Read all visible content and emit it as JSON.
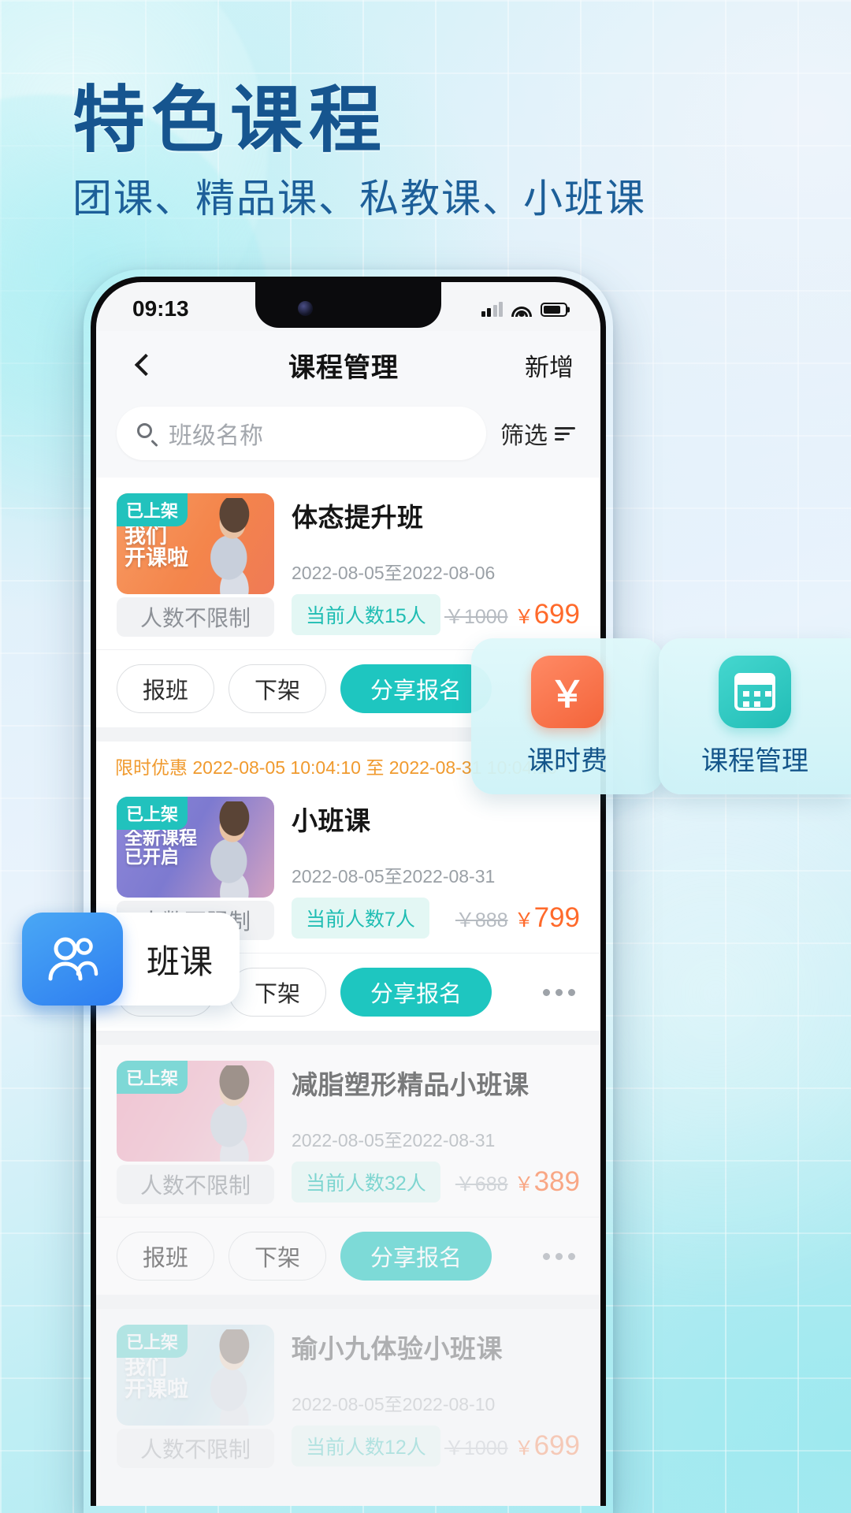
{
  "promo": {
    "title": "特色课程",
    "subtitle": "团课、精品课、私教课、小班课",
    "title_color": "#16558f"
  },
  "status_bar": {
    "time": "09:13",
    "signal_icon": "signal-bars-icon",
    "wifi_icon": "wifi-icon",
    "battery_icon": "battery-icon"
  },
  "appbar": {
    "back_icon": "back-chevron-icon",
    "title": "课程管理",
    "action_label": "新增"
  },
  "search": {
    "icon": "search-icon",
    "placeholder": "班级名称",
    "value": "",
    "filter_label": "筛选",
    "filter_icon": "filter-lines-icon"
  },
  "actions": {
    "enroll": "报班",
    "unlist": "下架",
    "share": "分享报名",
    "more_icon": "more-dots-icon"
  },
  "labels": {
    "capacity_unlimited": "人数不限制",
    "status_listed": "已上架"
  },
  "cards": [
    {
      "badge": "已上架",
      "thumb_line1": "我们",
      "thumb_line2": "开课啦",
      "capacity": "人数不限制",
      "title": "体态提升班",
      "date": "2022-08-05至2022-08-06",
      "count": "当前人数15人",
      "price_old": "￥1000",
      "price_new": "699",
      "promo": "",
      "btn_enroll": "报班",
      "btn_unlist": "下架",
      "btn_share": "分享报名"
    },
    {
      "badge": "已上架",
      "thumb_line1": "全新课程",
      "thumb_line2": "已开启",
      "capacity": "人数不限制",
      "title": "小班课",
      "date": "2022-08-05至2022-08-31",
      "count": "当前人数7人",
      "price_old": "￥888",
      "price_new": "799",
      "promo": "限时优惠 2022-08-05 10:04:10 至 2022-08-31 10:04:10",
      "promo_prefix": "限时优惠",
      "btn_enroll": "报班",
      "btn_unlist": "下架",
      "btn_share": "分享报名"
    },
    {
      "badge": "已上架",
      "thumb_line1": "",
      "thumb_line2": "",
      "capacity": "人数不限制",
      "title": "减脂塑形精品小班课",
      "date": "2022-08-05至2022-08-31",
      "count": "当前人数32人",
      "price_old": "￥688",
      "price_new": "389",
      "promo": "",
      "btn_enroll": "报班",
      "btn_unlist": "下架",
      "btn_share": "分享报名"
    },
    {
      "badge": "已上架",
      "thumb_line1": "我们",
      "thumb_line2": "开课啦",
      "capacity": "人数不限制",
      "title": "瑜小九体验小班课",
      "date": "2022-08-05至2022-08-10",
      "count": "当前人数12人",
      "price_old": "￥1000",
      "price_new": "699",
      "promo": "",
      "btn_enroll": "报班",
      "btn_unlist": "下架",
      "btn_share": "分享报名"
    }
  ],
  "float_features": [
    {
      "icon": "yen-fee-icon",
      "glyph": "￥",
      "label": "课时费"
    },
    {
      "icon": "calendar-course-icon",
      "glyph": "",
      "label": "课程管理"
    }
  ],
  "float_left": {
    "icon": "users-group-icon",
    "label": "班课"
  },
  "colors": {
    "accent_teal": "#1ec6c0",
    "price_orange": "#ff6a2b",
    "promo_orange": "#f5a623",
    "heading_blue": "#16558f"
  }
}
